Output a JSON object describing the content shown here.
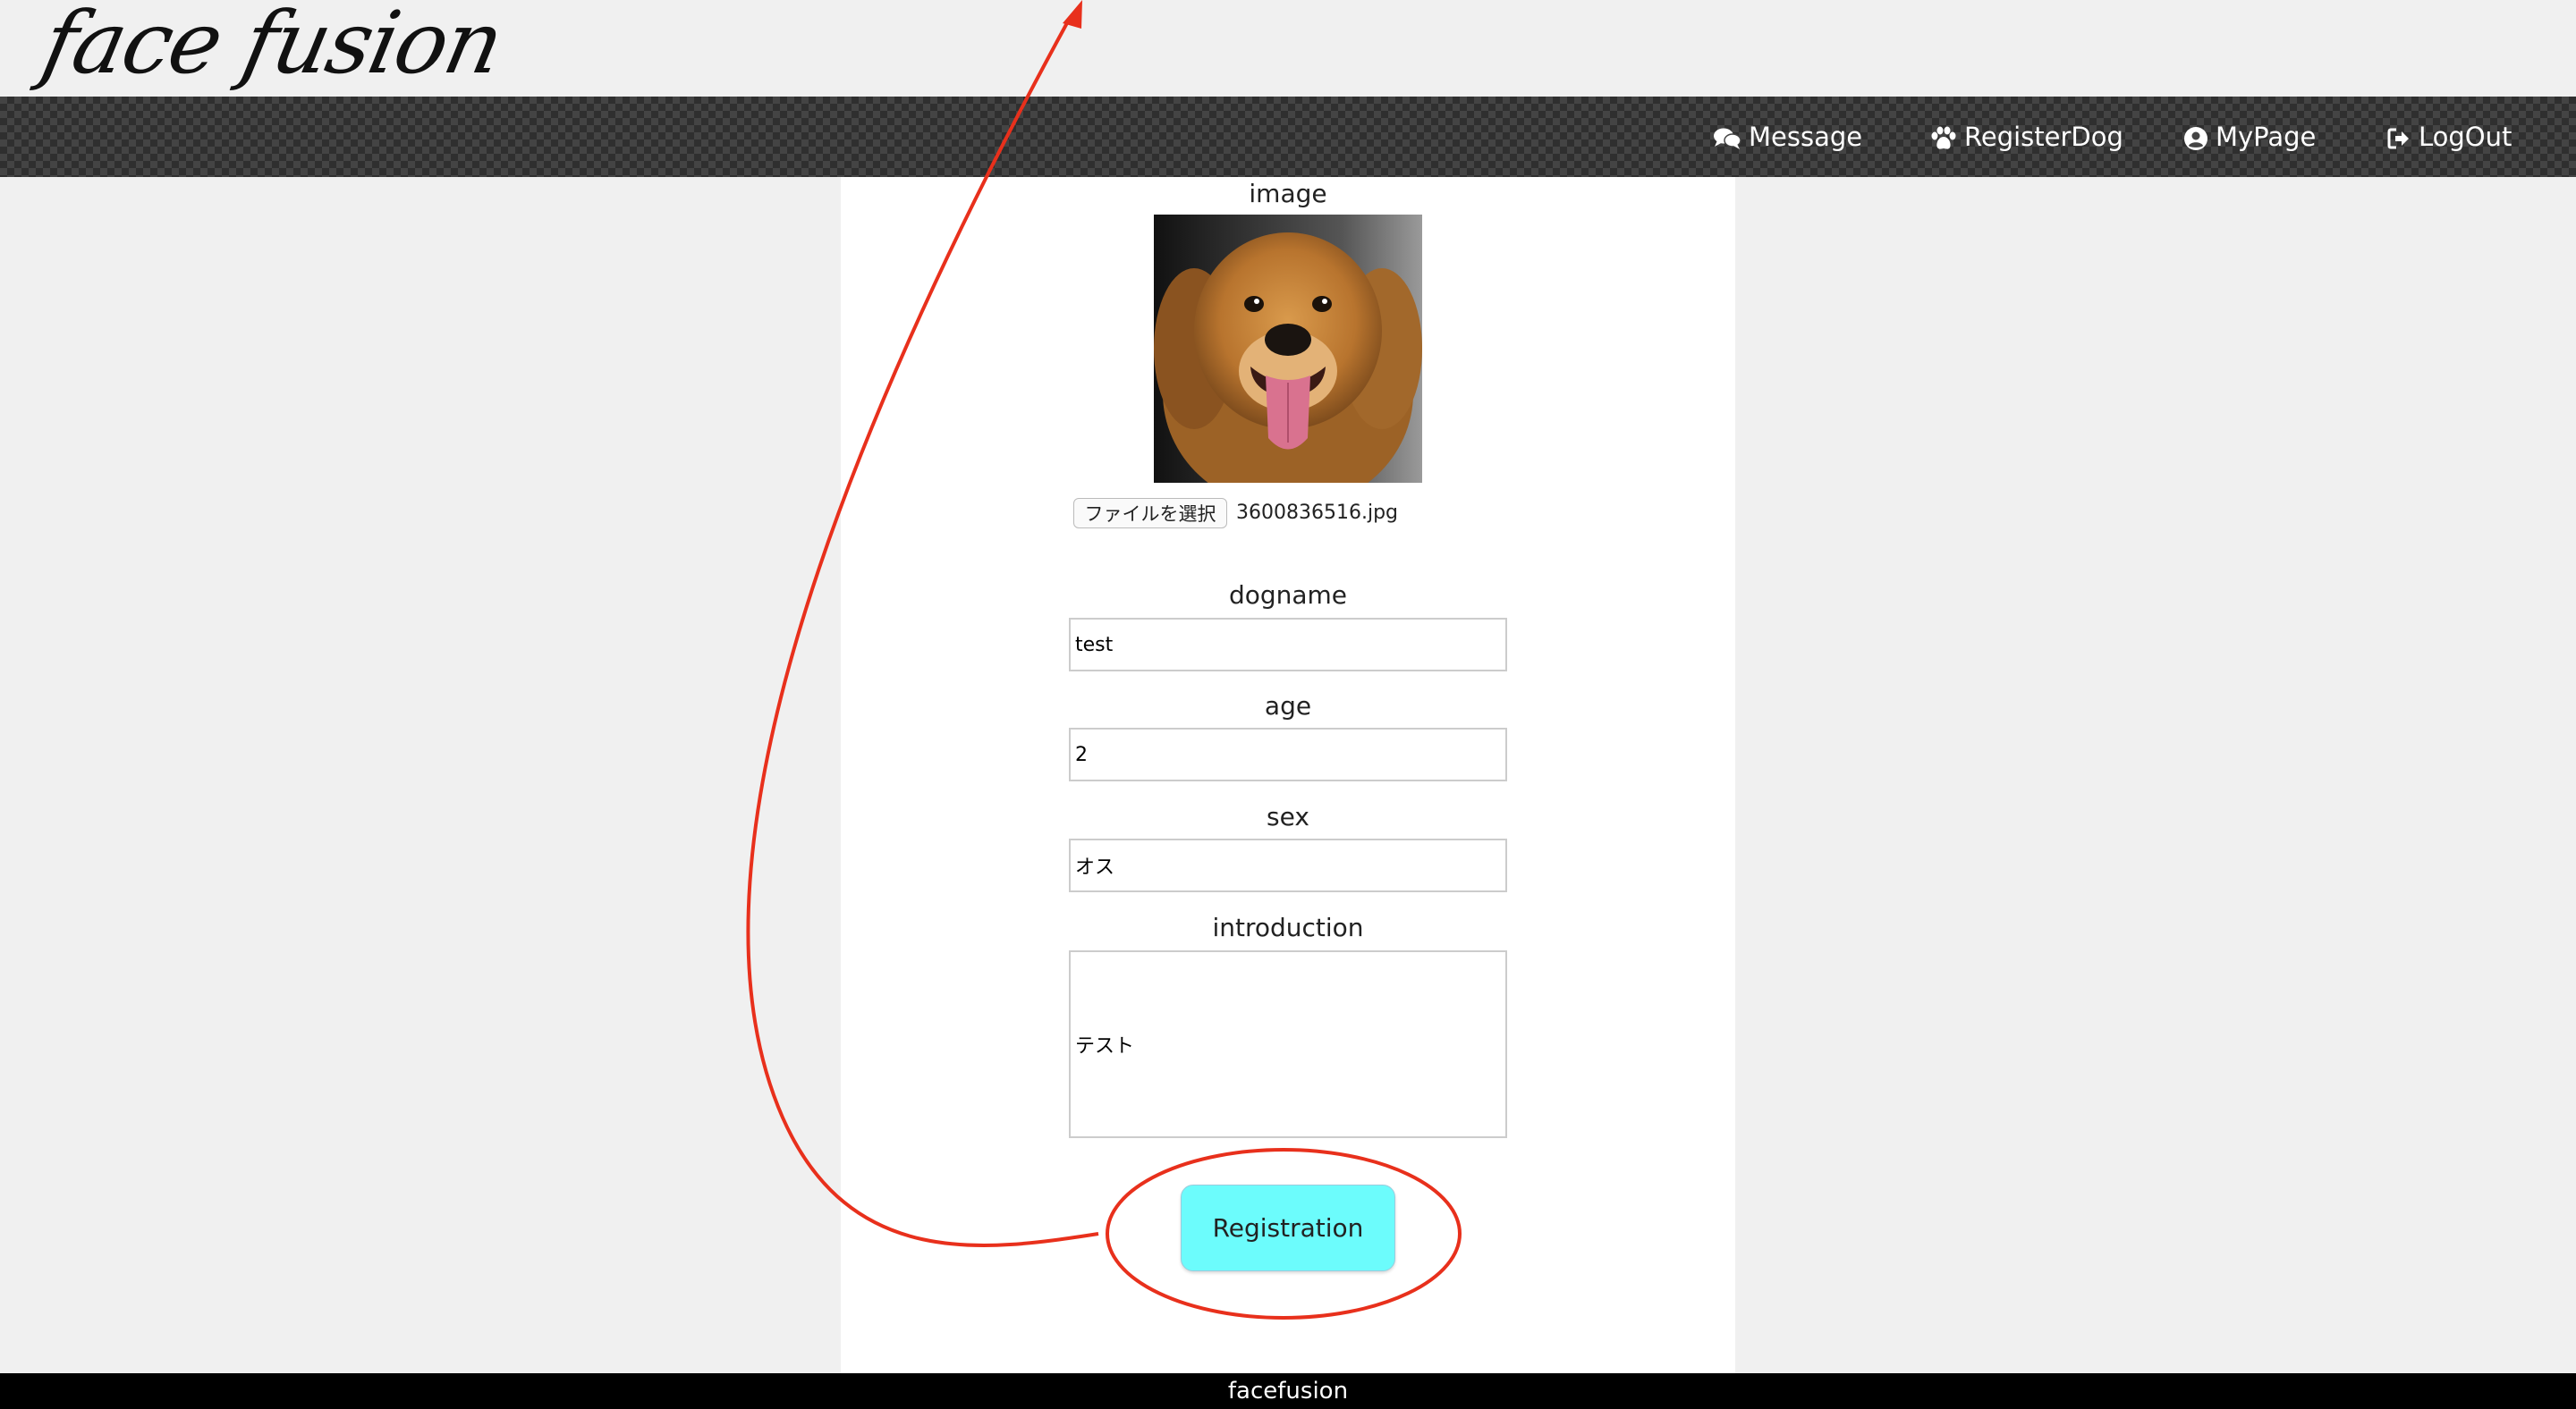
{
  "header": {
    "logo_text": "face fusion"
  },
  "nav": {
    "items": [
      {
        "label": "Message",
        "icon": "comments-icon"
      },
      {
        "label": "RegisterDog",
        "icon": "paw-icon"
      },
      {
        "label": "MyPage",
        "icon": "user-circle-icon"
      },
      {
        "label": "LogOut",
        "icon": "sign-out-icon"
      }
    ]
  },
  "form": {
    "image_label": "image",
    "file_button_label": "ファイルを選択",
    "file_name": "3600836516.jpg",
    "dogname_label": "dogname",
    "dogname_value": "test",
    "age_label": "age",
    "age_value": "2",
    "sex_label": "sex",
    "sex_value": "オス",
    "introduction_label": "introduction",
    "introduction_value": "テスト",
    "submit_label": "Registration"
  },
  "annotation": {
    "color": "#e8301c"
  },
  "footer": {
    "text": "facefusion"
  }
}
